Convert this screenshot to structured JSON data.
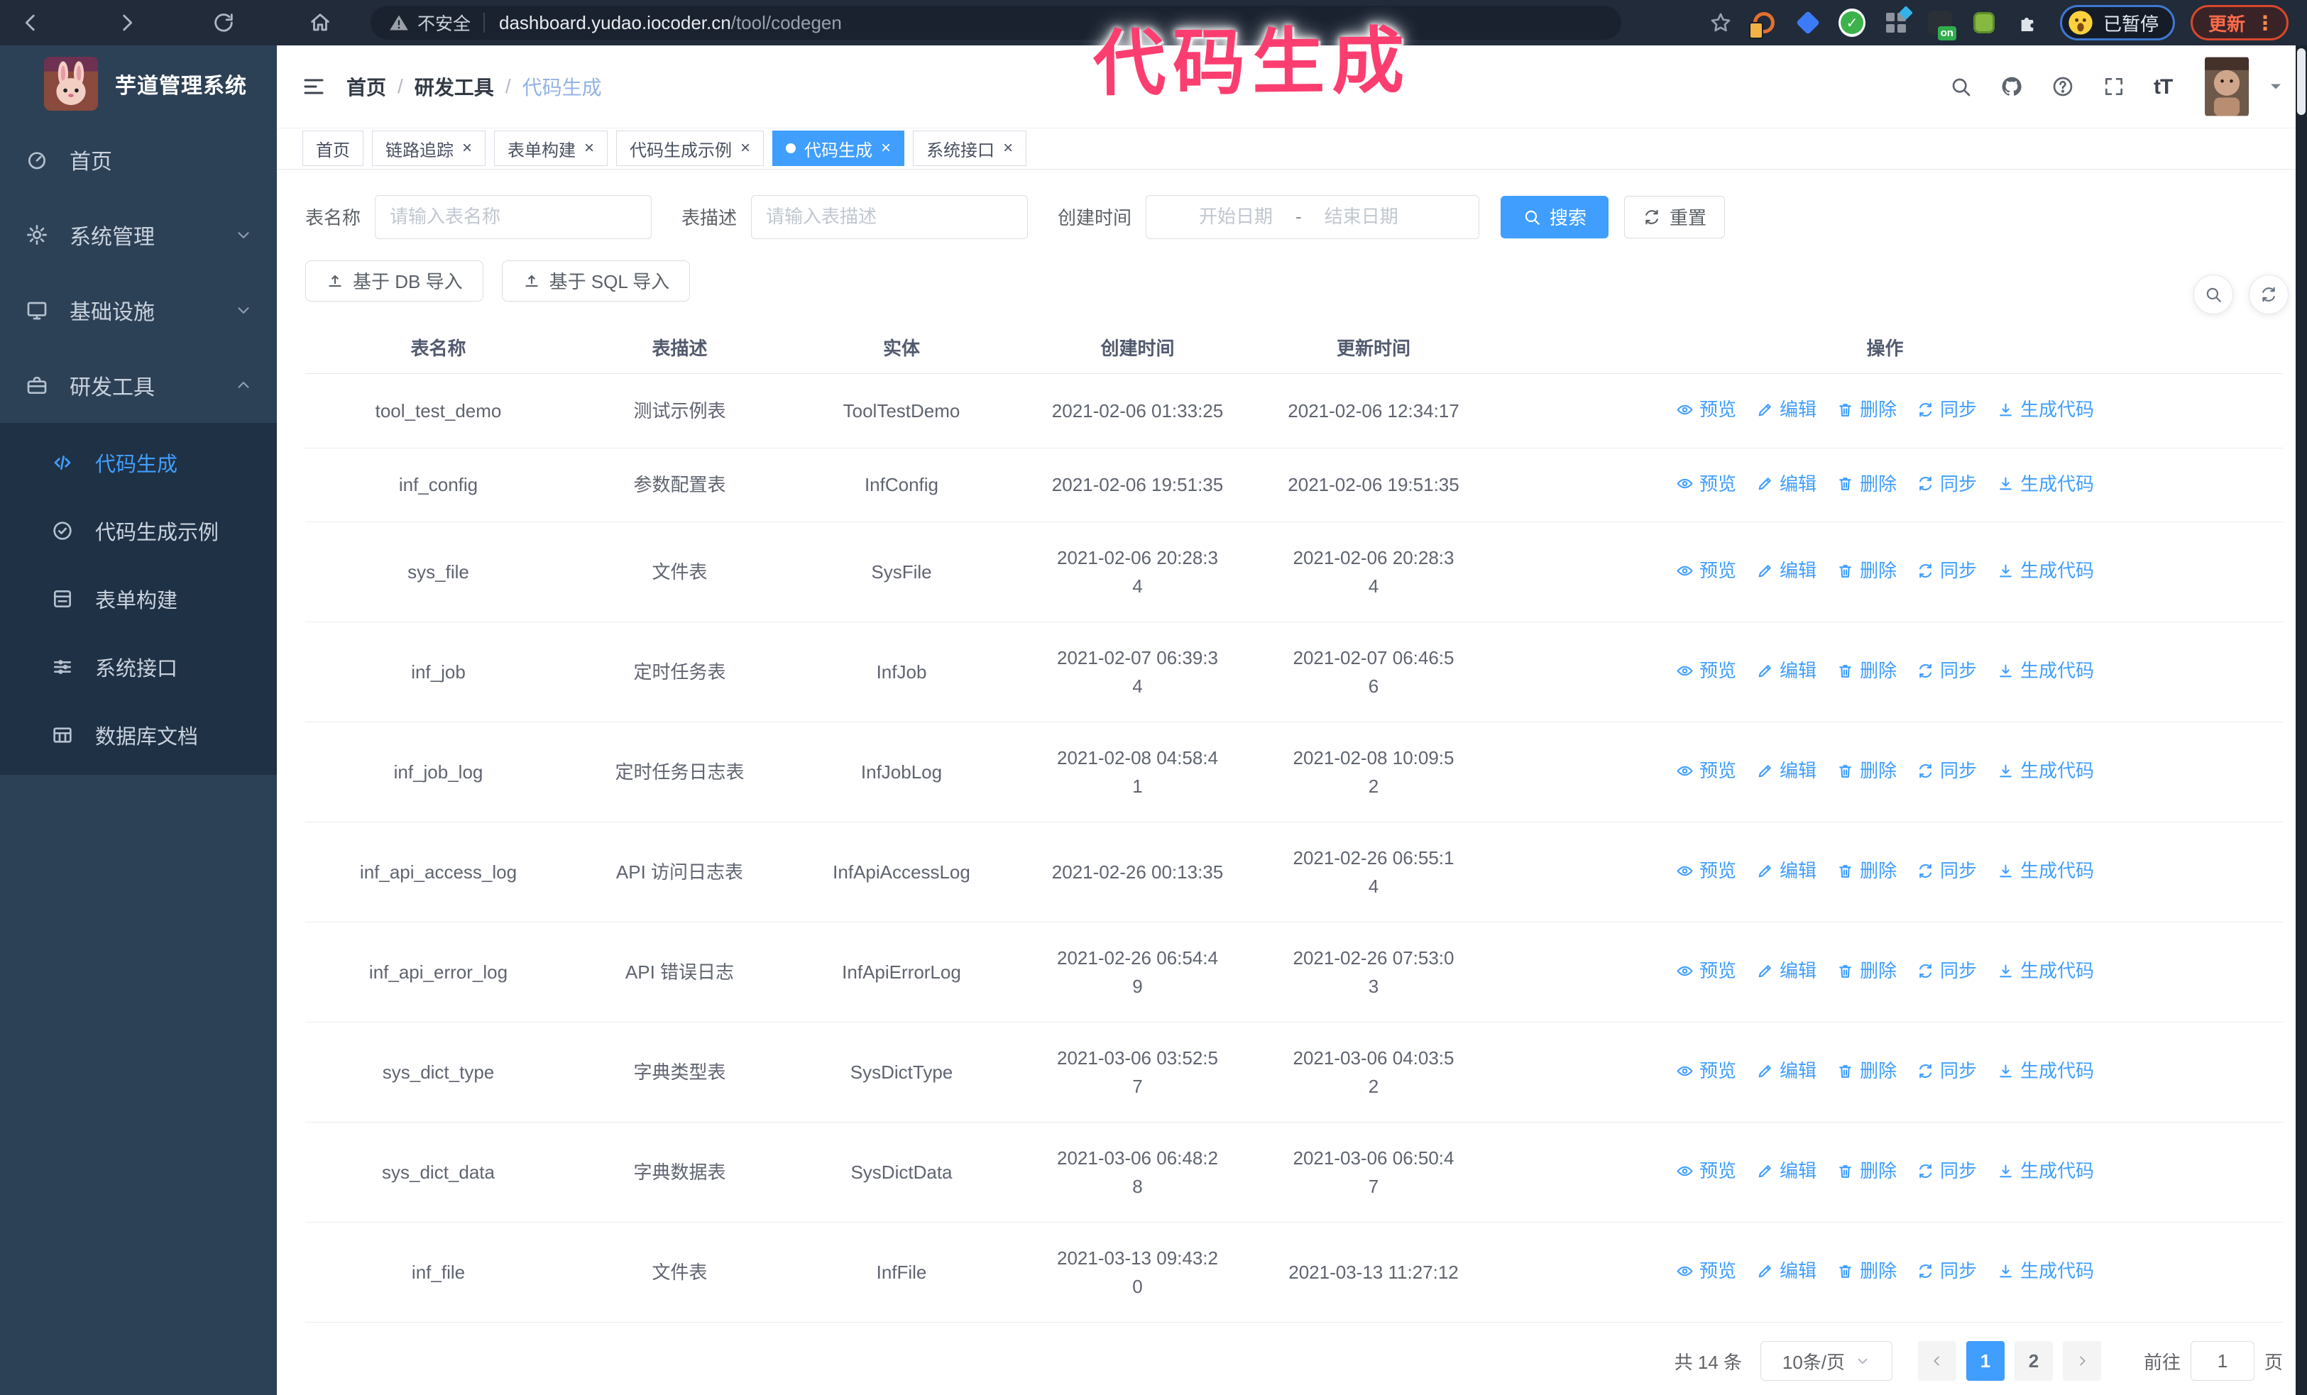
{
  "browser": {
    "nav_icons": [
      "back-icon",
      "forward-icon",
      "reload-icon",
      "home-icon"
    ],
    "security_label": "不安全",
    "url_host": "dashboard.yudao.iocoder.cn",
    "url_path": "/tool/codegen",
    "paused_badge": "已暂停",
    "update_button": "更新",
    "annotation": "代码生成",
    "extensions": [
      {
        "name": "ext-orange-ring-icon",
        "kind": "ring",
        "color": "#e2702e",
        "badge": "#f2b244"
      },
      {
        "name": "ext-blue-gem-icon",
        "kind": "diamond",
        "color": "#3b7bf5"
      },
      {
        "name": "ext-green-check-icon",
        "kind": "check",
        "color": "#3cb34a",
        "glyph": "✓"
      },
      {
        "name": "ext-grid-icon",
        "kind": "grid",
        "color": "#8d949e",
        "badge": "#35b3e8"
      },
      {
        "name": "ext-dark-on-icon",
        "kind": "darkon",
        "color": "#2b2f36",
        "badge": "#2fae4e",
        "badge_text": "on"
      },
      {
        "name": "ext-green-bot-icon",
        "kind": "bot",
        "color": "#86b93f"
      },
      {
        "name": "ext-puzzle-icon",
        "kind": "puzzle",
        "color": "#dfe4ea"
      }
    ]
  },
  "sidebar": {
    "title": "芋道管理系统",
    "menu": [
      {
        "key": "home",
        "label": "首页",
        "icon": "dashboard-icon",
        "chevron": ""
      },
      {
        "key": "system-management",
        "label": "系统管理",
        "icon": "gear-icon",
        "chevron": "down"
      },
      {
        "key": "infrastructure",
        "label": "基础设施",
        "icon": "monitor-icon",
        "chevron": "down"
      },
      {
        "key": "dev-tools",
        "label": "研发工具",
        "icon": "toolbox-icon",
        "chevron": "up"
      }
    ],
    "submenu": [
      {
        "key": "codegen",
        "label": "代码生成",
        "icon": "code-icon",
        "active": true
      },
      {
        "key": "codegen-demo",
        "label": "代码生成示例",
        "icon": "circle-check-icon",
        "active": false
      },
      {
        "key": "form-builder",
        "label": "表单构建",
        "icon": "form-icon",
        "active": false
      },
      {
        "key": "system-api",
        "label": "系统接口",
        "icon": "sliders-icon",
        "active": false
      },
      {
        "key": "db-doc",
        "label": "数据库文档",
        "icon": "database-icon",
        "active": false
      }
    ]
  },
  "navbar": {
    "breadcrumb": [
      "首页",
      "研发工具",
      "代码生成"
    ],
    "right_icons": [
      "search-icon",
      "github-icon",
      "help-icon",
      "fullscreen-icon",
      "fontsize-icon"
    ]
  },
  "tabs": [
    {
      "key": "home",
      "label": "首页",
      "closable": false,
      "active": false
    },
    {
      "key": "tracing",
      "label": "链路追踪",
      "closable": true,
      "active": false
    },
    {
      "key": "form-builder",
      "label": "表单构建",
      "closable": true,
      "active": false
    },
    {
      "key": "codegen-demo",
      "label": "代码生成示例",
      "closable": true,
      "active": false
    },
    {
      "key": "codegen",
      "label": "代码生成",
      "closable": true,
      "active": true
    },
    {
      "key": "system-api",
      "label": "系统接口",
      "closable": true,
      "active": false
    }
  ],
  "search": {
    "name_label": "表名称",
    "name_placeholder": "请输入表名称",
    "desc_label": "表描述",
    "desc_placeholder": "请输入表描述",
    "time_label": "创建时间",
    "start_placeholder": "开始日期",
    "range_separator": "-",
    "end_placeholder": "结束日期",
    "search_button": "搜索",
    "reset_button": "重置"
  },
  "toolbar": {
    "import_db": "基于 DB 导入",
    "import_sql": "基于 SQL 导入"
  },
  "table": {
    "columns": [
      "表名称",
      "表描述",
      "实体",
      "创建时间",
      "更新时间",
      "操作"
    ],
    "actions": [
      "预览",
      "编辑",
      "删除",
      "同步",
      "生成代码"
    ],
    "action_keys": [
      "preview",
      "edit",
      "delete",
      "sync",
      "generate"
    ],
    "action_icons": [
      "eye-icon",
      "edit-icon",
      "delete-icon",
      "sync-icon",
      "download-icon"
    ],
    "rows": [
      {
        "name": "tool_test_demo",
        "desc": "测试示例表",
        "entity": "ToolTestDemo",
        "created": "2021-02-06 01:33:25",
        "updated": "2021-02-06 12:34:17"
      },
      {
        "name": "inf_config",
        "desc": "参数配置表",
        "entity": "InfConfig",
        "created": "2021-02-06 19:51:35",
        "updated": "2021-02-06 19:51:35"
      },
      {
        "name": "sys_file",
        "desc": "文件表",
        "entity": "SysFile",
        "created": "2021-02-06 20:28:3\n4",
        "updated": "2021-02-06 20:28:3\n4"
      },
      {
        "name": "inf_job",
        "desc": "定时任务表",
        "entity": "InfJob",
        "created": "2021-02-07 06:39:3\n4",
        "updated": "2021-02-07 06:46:5\n6"
      },
      {
        "name": "inf_job_log",
        "desc": "定时任务日志表",
        "entity": "InfJobLog",
        "created": "2021-02-08 04:58:4\n1",
        "updated": "2021-02-08 10:09:5\n2"
      },
      {
        "name": "inf_api_access_log",
        "desc": "API 访问日志表",
        "entity": "InfApiAccessLog",
        "created": "2021-02-26 00:13:35",
        "updated": "2021-02-26 06:55:1\n4"
      },
      {
        "name": "inf_api_error_log",
        "desc": "API 错误日志",
        "entity": "InfApiErrorLog",
        "created": "2021-02-26 06:54:4\n9",
        "updated": "2021-02-26 07:53:0\n3"
      },
      {
        "name": "sys_dict_type",
        "desc": "字典类型表",
        "entity": "SysDictType",
        "created": "2021-03-06 03:52:5\n7",
        "updated": "2021-03-06 04:03:5\n2"
      },
      {
        "name": "sys_dict_data",
        "desc": "字典数据表",
        "entity": "SysDictData",
        "created": "2021-03-06 06:48:2\n8",
        "updated": "2021-03-06 06:50:4\n7"
      },
      {
        "name": "inf_file",
        "desc": "文件表",
        "entity": "InfFile",
        "created": "2021-03-13 09:43:2\n0",
        "updated": "2021-03-13 11:27:12"
      }
    ]
  },
  "pagination": {
    "total": "共 14 条",
    "page_size": "10条/页",
    "pages": [
      "1",
      "2"
    ],
    "active_page": "1",
    "goto_label": "前往",
    "goto_value": "1",
    "page_suffix": "页"
  },
  "colors": {
    "accent": "#409eff",
    "annotation": "#fb3e6f",
    "sidebar_bg": "#2d4156",
    "submenu_bg": "#1f3144",
    "browser_bar_bg": "#212b3a"
  }
}
